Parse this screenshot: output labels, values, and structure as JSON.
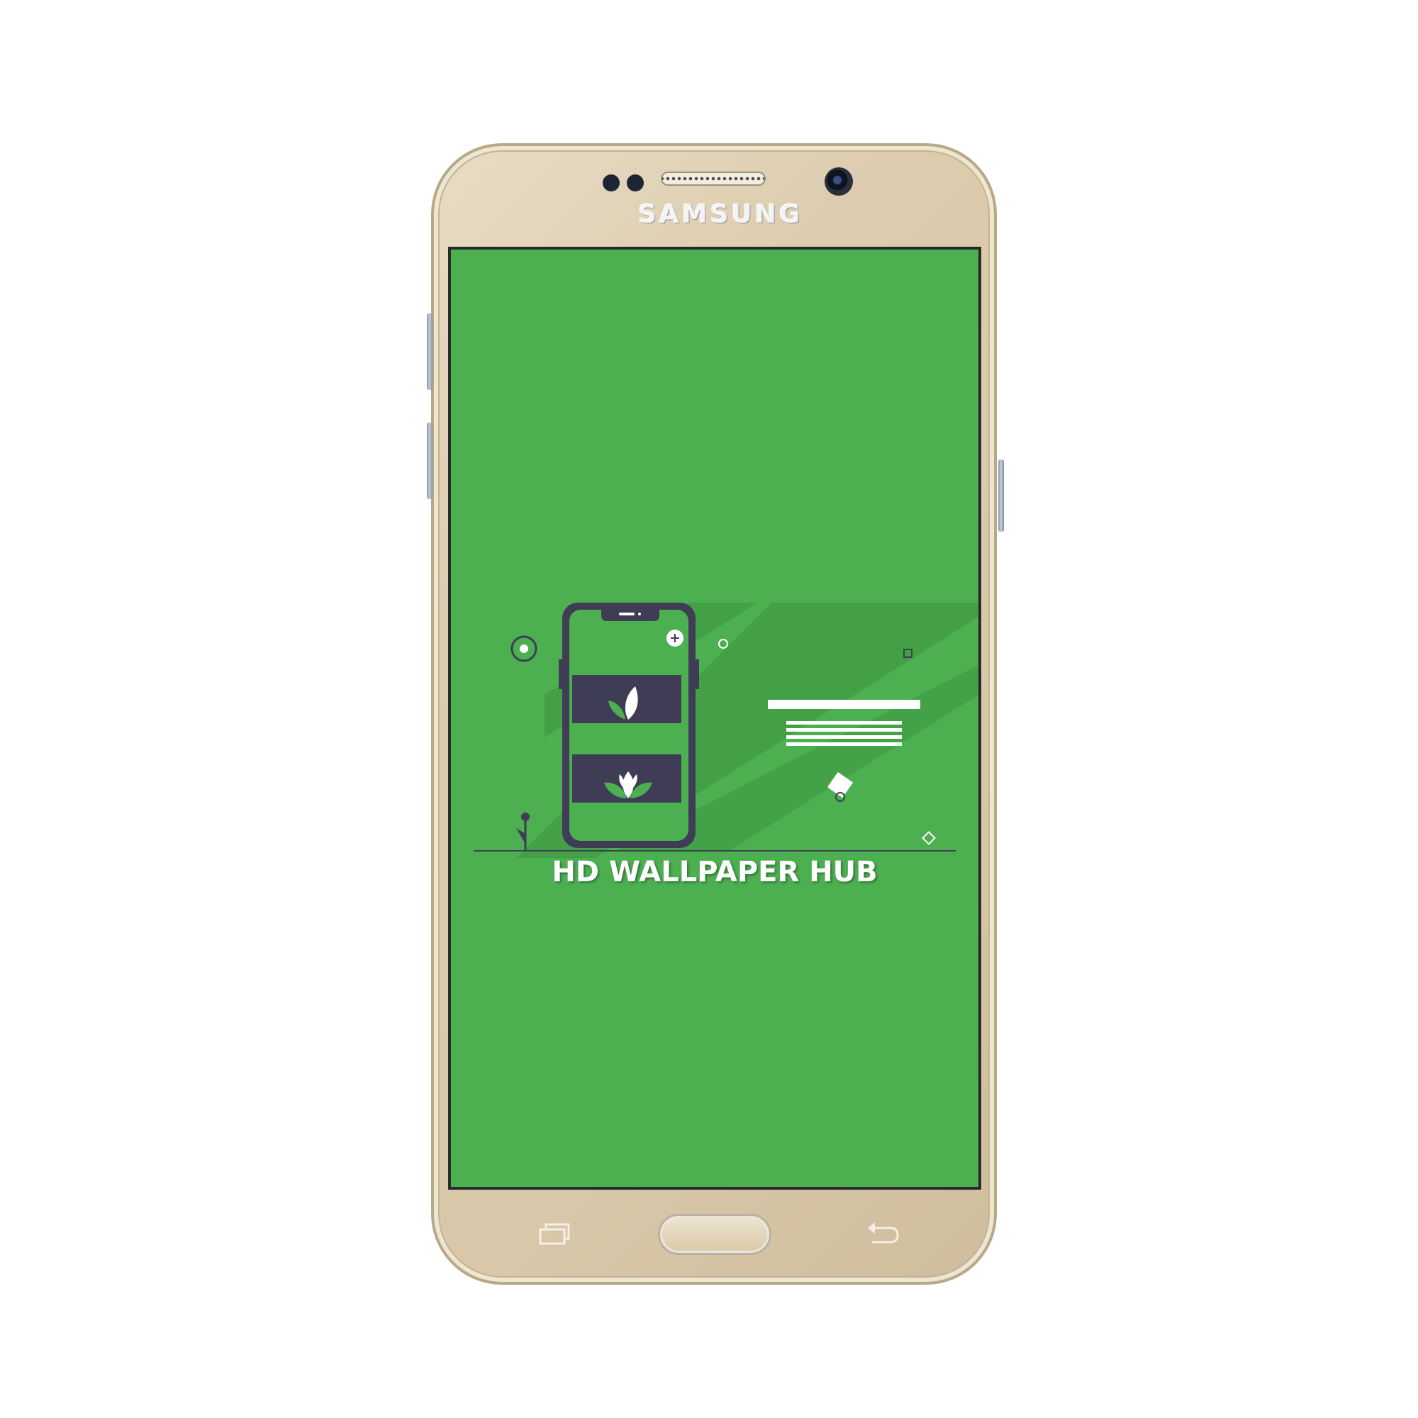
{
  "device": {
    "brand": "SAMSUNG",
    "body_color": "#dccbad",
    "icons": [
      "sensor-icon",
      "speaker-grille-icon",
      "front-camera-icon",
      "recent-apps-icon",
      "home-button",
      "back-icon"
    ]
  },
  "screen": {
    "background_color": "#4caf50",
    "app_title": "HD WALLPAPER HUB",
    "illustration": {
      "description_icons": [
        "phone-illustration-icon",
        "leaf-icon",
        "lotus-icon",
        "plus-icon",
        "plant-icon"
      ],
      "accent_dark": "#3f3d56",
      "accent_light": "#ffffff"
    }
  }
}
